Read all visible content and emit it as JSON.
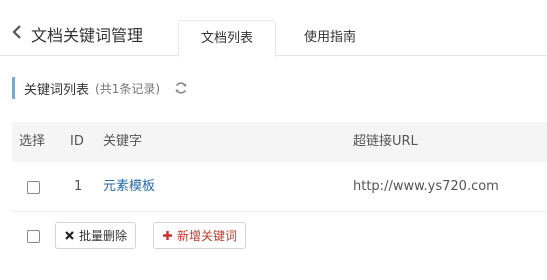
{
  "header": {
    "title": "文档关键词管理",
    "tabs": [
      {
        "label": "文档列表",
        "active": true
      },
      {
        "label": "使用指南",
        "active": false
      }
    ]
  },
  "section": {
    "title": "关键词列表",
    "count": "(共1条记录)"
  },
  "table": {
    "columns": [
      "选择",
      "ID",
      "关键字",
      "超链接URL"
    ],
    "rows": [
      {
        "id": "1",
        "keyword": "元素模板",
        "url": "http://www.ys720.com"
      }
    ]
  },
  "actions": {
    "batch_delete": "批量删除",
    "add_keyword": "新增关键词"
  },
  "icons": {
    "back": "chevron-left-icon",
    "refresh": "refresh-icon",
    "delete": "close-icon",
    "add": "plus-icon"
  },
  "colors": {
    "accent_bar": "#7fa8c9",
    "link": "#2a6aa8",
    "danger": "#c0392b",
    "table_header_bg": "#f5f5f5"
  }
}
